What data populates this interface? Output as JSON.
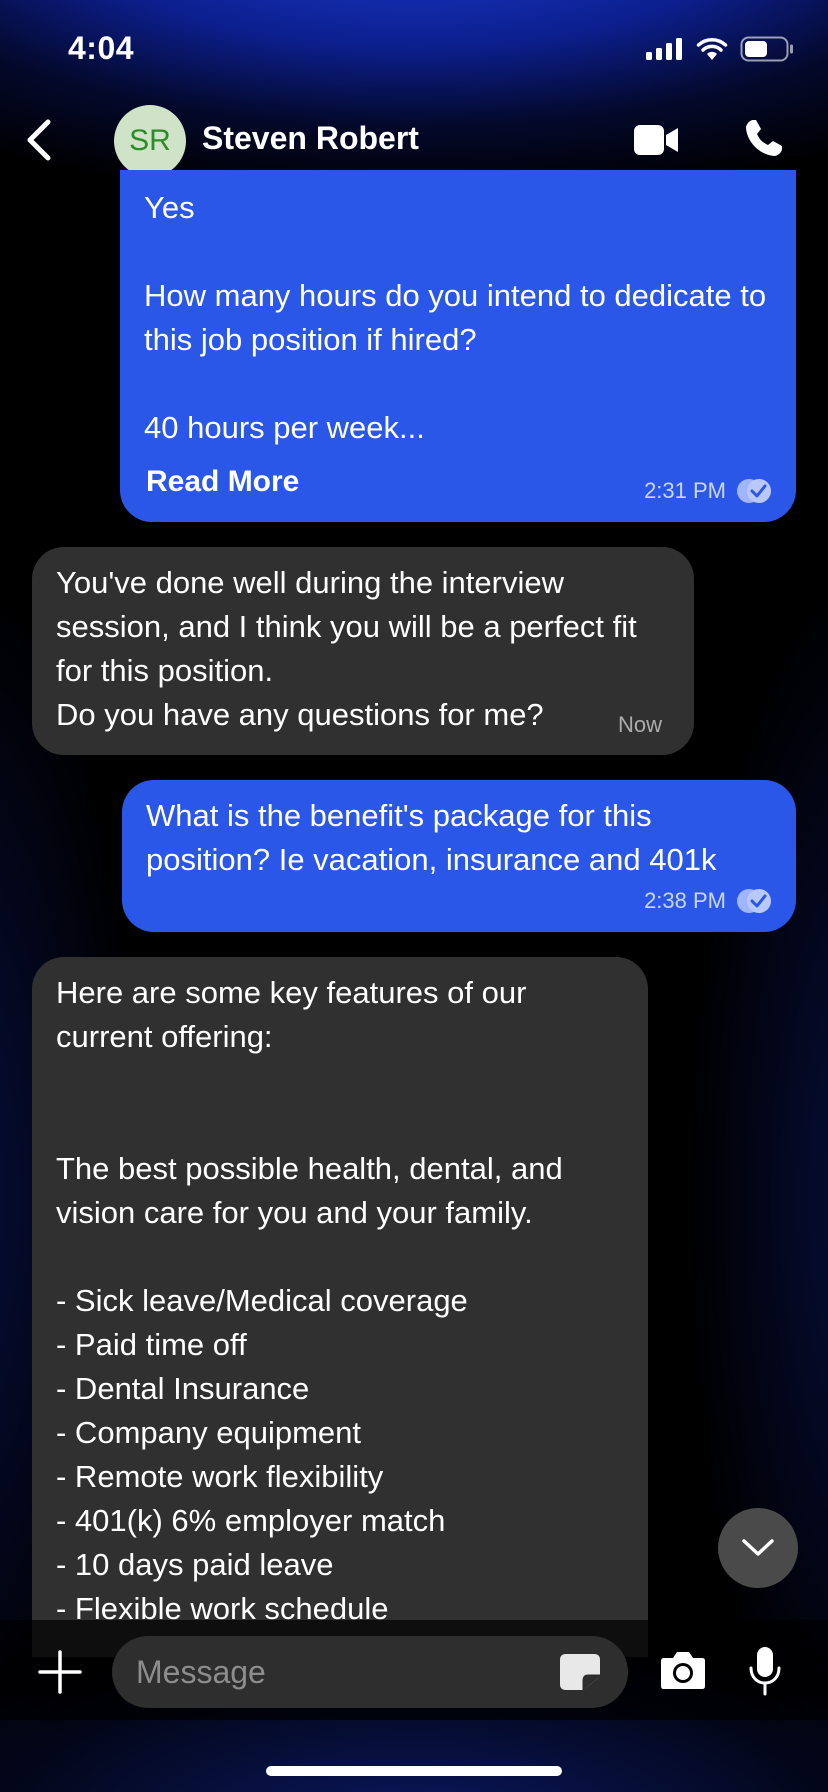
{
  "status_bar": {
    "time": "4:04"
  },
  "header": {
    "contact_initials": "SR",
    "contact_name": "Steven Robert"
  },
  "messages": [
    {
      "direction": "outgoing",
      "text": "Yes\n\nHow many hours do you intend to dedicate to this job position if hired?\n\n40 hours per week...",
      "read_more": "Read More",
      "time": "2:31 PM"
    },
    {
      "direction": "incoming",
      "text": "You've done well during the interview session, and I think you will be a perfect fit for this position.\nDo you have any questions for me?",
      "time": "Now"
    },
    {
      "direction": "outgoing",
      "text": "What is the benefit's package for this position? Ie vacation, insurance and 401k",
      "time": "2:38 PM"
    },
    {
      "direction": "incoming",
      "text": "Here are some key features of our current offering:\n\n\nThe best possible health, dental, and vision care for you and your family.\n\n- Sick leave/Medical coverage\n- Paid time off\n- Dental Insurance\n- Company equipment\n- Remote work flexibility\n- 401(k) 6% employer match\n- 10 days paid leave\n- Flexible work schedule"
    }
  ],
  "composer": {
    "placeholder": "Message"
  },
  "colors": {
    "outgoing_bubble": "#2b57e8",
    "incoming_bubble": "#303030",
    "avatar_bg": "#cfe3c8",
    "avatar_text": "#2f8a2a"
  }
}
